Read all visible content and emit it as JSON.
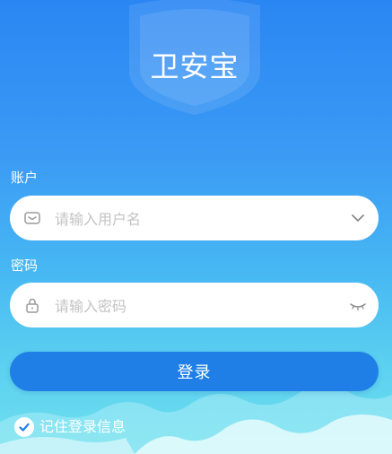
{
  "app": {
    "title": "卫安宝"
  },
  "account": {
    "label": "账户",
    "placeholder": "请输入用户名",
    "value": ""
  },
  "password": {
    "label": "密码",
    "placeholder": "请输入密码",
    "value": ""
  },
  "login_button": {
    "label": "登录"
  },
  "remember": {
    "label": "记住登录信息",
    "checked": true
  },
  "icons": {
    "account_lead": "mail-icon",
    "account_trail": "chevron-down-icon",
    "password_lead": "lock-icon",
    "password_trail": "eye-closed-icon",
    "remember_check": "check-icon"
  },
  "colors": {
    "button": "#1f7fe6",
    "background_top": "#2a86f3",
    "background_bottom": "#6fe0ee",
    "check": "#1f7fe6",
    "icon": "#9a9a9a"
  }
}
